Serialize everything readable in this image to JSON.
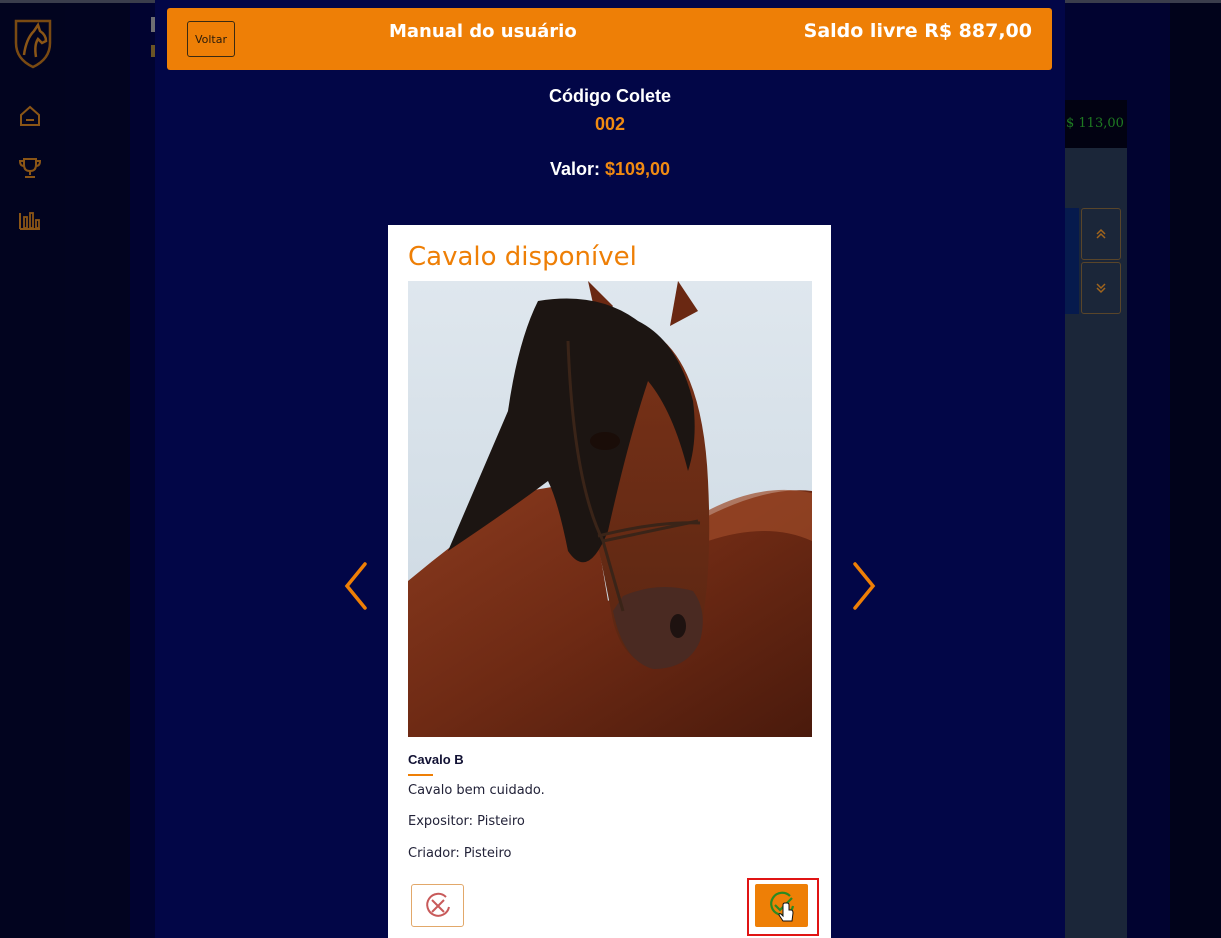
{
  "background": {
    "price_snippet": "$ 113,00"
  },
  "modal": {
    "back_label": "Voltar",
    "title": "Manual do usuário",
    "balance": "Saldo livre R$ 887,00",
    "code_label": "Código Colete",
    "code_value": "002",
    "price_label": "Valor:",
    "price_value": "$109,00"
  },
  "card": {
    "title": "Cavalo disponível",
    "horse_name": "Cavalo B",
    "description": "Cavalo bem cuidado.",
    "exhibitor": "Expositor: Pisteiro",
    "breeder": "Criador: Pisteiro"
  },
  "colors": {
    "accent": "#ee7f06",
    "modal_bg": "#020647",
    "page_bg": "#020420",
    "highlight": "#e01414"
  },
  "icons": {
    "logo": "horse-head-shield-icon",
    "nav": [
      "home-icon",
      "trophy-icon",
      "bar-chart-icon"
    ],
    "prev": "chevron-left-icon",
    "next": "chevron-right-icon",
    "reject": "x-circle-icon",
    "accept": "check-circle-icon",
    "pointer": "hand-pointer-icon"
  }
}
